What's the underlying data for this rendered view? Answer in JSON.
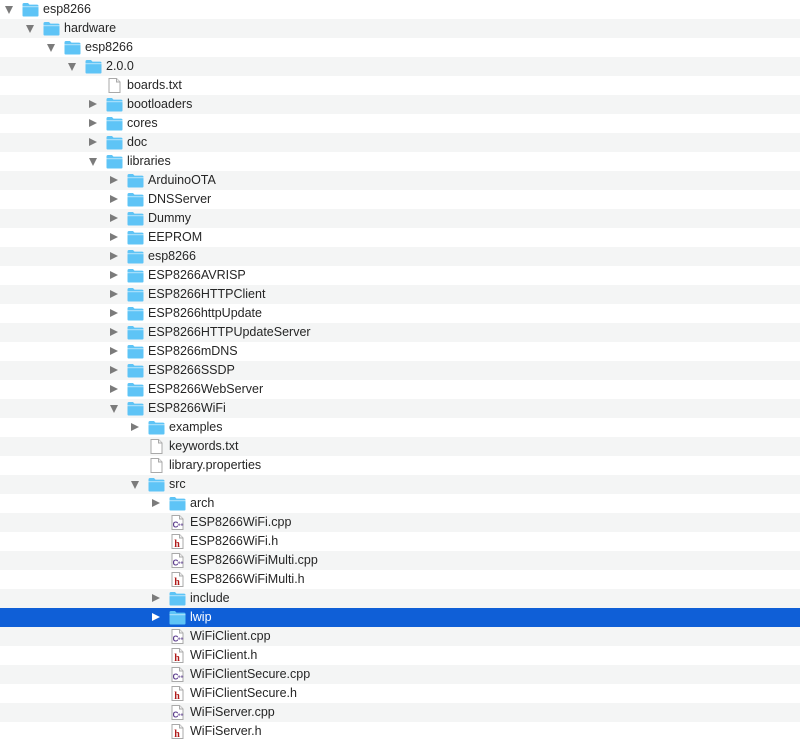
{
  "tree": [
    {
      "label": "esp8266",
      "type": "folder",
      "depth": 0,
      "expanded": true
    },
    {
      "label": "hardware",
      "type": "folder",
      "depth": 1,
      "expanded": true
    },
    {
      "label": "esp8266",
      "type": "folder",
      "depth": 2,
      "expanded": true
    },
    {
      "label": "2.0.0",
      "type": "folder",
      "depth": 3,
      "expanded": true
    },
    {
      "label": "boards.txt",
      "type": "text-file",
      "depth": 4
    },
    {
      "label": "bootloaders",
      "type": "folder",
      "depth": 4,
      "expanded": false
    },
    {
      "label": "cores",
      "type": "folder",
      "depth": 4,
      "expanded": false
    },
    {
      "label": "doc",
      "type": "folder",
      "depth": 4,
      "expanded": false
    },
    {
      "label": "libraries",
      "type": "folder",
      "depth": 4,
      "expanded": true
    },
    {
      "label": "ArduinoOTA",
      "type": "folder",
      "depth": 5,
      "expanded": false
    },
    {
      "label": "DNSServer",
      "type": "folder",
      "depth": 5,
      "expanded": false
    },
    {
      "label": "Dummy",
      "type": "folder",
      "depth": 5,
      "expanded": false
    },
    {
      "label": "EEPROM",
      "type": "folder",
      "depth": 5,
      "expanded": false
    },
    {
      "label": "esp8266",
      "type": "folder",
      "depth": 5,
      "expanded": false
    },
    {
      "label": "ESP8266AVRISP",
      "type": "folder",
      "depth": 5,
      "expanded": false
    },
    {
      "label": "ESP8266HTTPClient",
      "type": "folder",
      "depth": 5,
      "expanded": false
    },
    {
      "label": "ESP8266httpUpdate",
      "type": "folder",
      "depth": 5,
      "expanded": false
    },
    {
      "label": "ESP8266HTTPUpdateServer",
      "type": "folder",
      "depth": 5,
      "expanded": false
    },
    {
      "label": "ESP8266mDNS",
      "type": "folder",
      "depth": 5,
      "expanded": false
    },
    {
      "label": "ESP8266SSDP",
      "type": "folder",
      "depth": 5,
      "expanded": false
    },
    {
      "label": "ESP8266WebServer",
      "type": "folder",
      "depth": 5,
      "expanded": false
    },
    {
      "label": "ESP8266WiFi",
      "type": "folder",
      "depth": 5,
      "expanded": true
    },
    {
      "label": "examples",
      "type": "folder",
      "depth": 6,
      "expanded": false
    },
    {
      "label": "keywords.txt",
      "type": "text-file",
      "depth": 6
    },
    {
      "label": "library.properties",
      "type": "text-file",
      "depth": 6
    },
    {
      "label": "src",
      "type": "folder",
      "depth": 6,
      "expanded": true
    },
    {
      "label": "arch",
      "type": "folder",
      "depth": 7,
      "expanded": false
    },
    {
      "label": "ESP8266WiFi.cpp",
      "type": "cpp-file",
      "depth": 7
    },
    {
      "label": "ESP8266WiFi.h",
      "type": "h-file",
      "depth": 7
    },
    {
      "label": "ESP8266WiFiMulti.cpp",
      "type": "cpp-file",
      "depth": 7
    },
    {
      "label": "ESP8266WiFiMulti.h",
      "type": "h-file",
      "depth": 7
    },
    {
      "label": "include",
      "type": "folder",
      "depth": 7,
      "expanded": false
    },
    {
      "label": "lwip",
      "type": "folder",
      "depth": 7,
      "expanded": false,
      "selected": true
    },
    {
      "label": "WiFiClient.cpp",
      "type": "cpp-file",
      "depth": 7
    },
    {
      "label": "WiFiClient.h",
      "type": "h-file",
      "depth": 7
    },
    {
      "label": "WiFiClientSecure.cpp",
      "type": "cpp-file",
      "depth": 7
    },
    {
      "label": "WiFiClientSecure.h",
      "type": "h-file",
      "depth": 7
    },
    {
      "label": "WiFiServer.cpp",
      "type": "cpp-file",
      "depth": 7
    },
    {
      "label": "WiFiServer.h",
      "type": "h-file",
      "depth": 7
    }
  ],
  "colors": {
    "selection": "#0f5fd7",
    "stripe": "#f4f5f5",
    "folder": "#5ec4f6",
    "header_file": "#b01a1a",
    "cpp_file": "#5a3a8c"
  }
}
